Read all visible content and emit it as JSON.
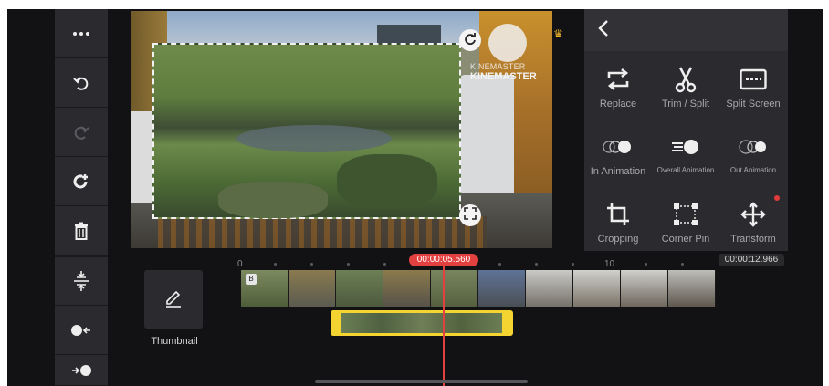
{
  "left_toolbar": {
    "items": [
      {
        "name": "more-menu",
        "icon": "ellipsis-icon"
      },
      {
        "name": "undo",
        "icon": "undo-icon"
      },
      {
        "name": "redo",
        "icon": "redo-icon"
      },
      {
        "name": "add-rotate",
        "icon": "rotate-plus-icon"
      },
      {
        "name": "delete",
        "icon": "trash-icon"
      },
      {
        "name": "split-view",
        "icon": "split-vertical-icon"
      },
      {
        "name": "jump-start",
        "icon": "jump-start-icon"
      },
      {
        "name": "jump-end",
        "icon": "jump-end-icon"
      }
    ]
  },
  "preview": {
    "watermark_small": "KINEMASTER",
    "watermark_large": "KINEMASTER"
  },
  "right_panel": {
    "back_icon": "chevron-left-icon",
    "tools": [
      {
        "label": "Replace",
        "icon": "replace-icon"
      },
      {
        "label": "Trim / Split",
        "icon": "scissors-icon"
      },
      {
        "label": "Split Screen",
        "icon": "split-screen-icon"
      },
      {
        "label": "In Animation",
        "icon": "in-animation-icon"
      },
      {
        "label": "Overall Animation",
        "icon": "overall-animation-icon"
      },
      {
        "label": "Out Animation",
        "icon": "out-animation-icon"
      },
      {
        "label": "Cropping",
        "icon": "crop-icon"
      },
      {
        "label": "Corner Pin",
        "icon": "corner-pin-icon"
      },
      {
        "label": "Transform",
        "icon": "transform-icon"
      }
    ]
  },
  "timeline": {
    "current_time": "00:00:05.560",
    "total_time": "00:00:12.966",
    "ruler_labels": [
      "0",
      "10"
    ],
    "thumbnail_label": "Thumbnail",
    "clip_badge": "B"
  },
  "colors": {
    "accent_red": "#e34040",
    "layer_yellow": "#f4d430",
    "panel_bg": "#2b2b2f"
  }
}
